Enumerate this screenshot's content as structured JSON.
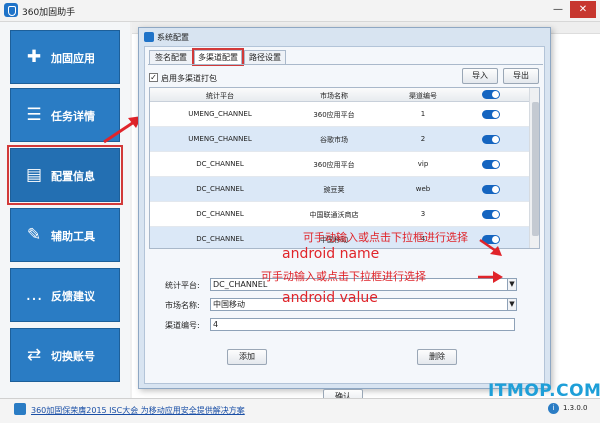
{
  "window": {
    "title": "360加固助手",
    "minimize_icon": "minimize-icon",
    "close_icon": "close-icon"
  },
  "sidebar": {
    "items": [
      {
        "label": "加固应用",
        "icon": "shield-plus-icon",
        "glyph": "✚"
      },
      {
        "label": "任务详情",
        "icon": "document-list-icon",
        "glyph": "☰"
      },
      {
        "label": "配置信息",
        "icon": "clipboard-icon",
        "glyph": "▤",
        "active": true
      },
      {
        "label": "辅助工具",
        "icon": "wrench-icon",
        "glyph": "✎"
      },
      {
        "label": "反馈建议",
        "icon": "chat-icon",
        "glyph": "…"
      },
      {
        "label": "切换账号",
        "icon": "swap-icon",
        "glyph": "⇄"
      }
    ]
  },
  "dialog": {
    "title": "系统配置",
    "tabs": [
      "签名配置",
      "多渠道配置",
      "路径设置"
    ],
    "active_tab": "多渠道配置",
    "enable_checkbox": {
      "label": "启用多渠道打包",
      "checked": true,
      "mark": "✓"
    },
    "import_label": "导入",
    "export_label": "导出",
    "table": {
      "columns": [
        "统计平台",
        "市场名称",
        "渠道编号",
        ""
      ],
      "rows": [
        {
          "platform": "UMENG_CHANNEL",
          "market": "360应用平台",
          "channel": "1",
          "enabled": true
        },
        {
          "platform": "UMENG_CHANNEL",
          "market": "谷歌市场",
          "channel": "2",
          "enabled": true
        },
        {
          "platform": "DC_CHANNEL",
          "market": "360应用平台",
          "channel": "vip",
          "enabled": true
        },
        {
          "platform": "DC_CHANNEL",
          "market": "豌豆荚",
          "channel": "web",
          "enabled": true
        },
        {
          "platform": "DC_CHANNEL",
          "market": "中国联通沃商店",
          "channel": "3",
          "enabled": true
        },
        {
          "platform": "DC_CHANNEL",
          "market": "中国移动",
          "channel": "4",
          "enabled": true
        }
      ]
    },
    "form": {
      "platform_label": "统计平台:",
      "platform_value": "DC_CHANNEL",
      "market_label": "市场名称:",
      "market_value": "中国移动",
      "channel_label": "渠道编号:",
      "channel_value": "4",
      "dropdown_glyph": "▼"
    },
    "add_label": "添加",
    "delete_label": "删除",
    "ok_label": "确认"
  },
  "annotations": {
    "hint1": "可手动输入或点击下拉框进行选择",
    "name_note": "android name",
    "hint2": "可手动输入或点击下拉框进行选择",
    "value_note": "android value",
    "color": "#e0242a"
  },
  "status": {
    "link_text": "360加固保荣膺2015 ISC大会 为移动应用安全提供解决方案",
    "version": "1.3.0.0",
    "version_icon": "info-icon"
  },
  "watermark": "ITMOP.COM",
  "colors": {
    "sidebar_blue": "#2a7cc4",
    "toggle_on": "#1565c0",
    "selected_row": "#dbe8f7",
    "highlight_red": "#d23a3a"
  }
}
